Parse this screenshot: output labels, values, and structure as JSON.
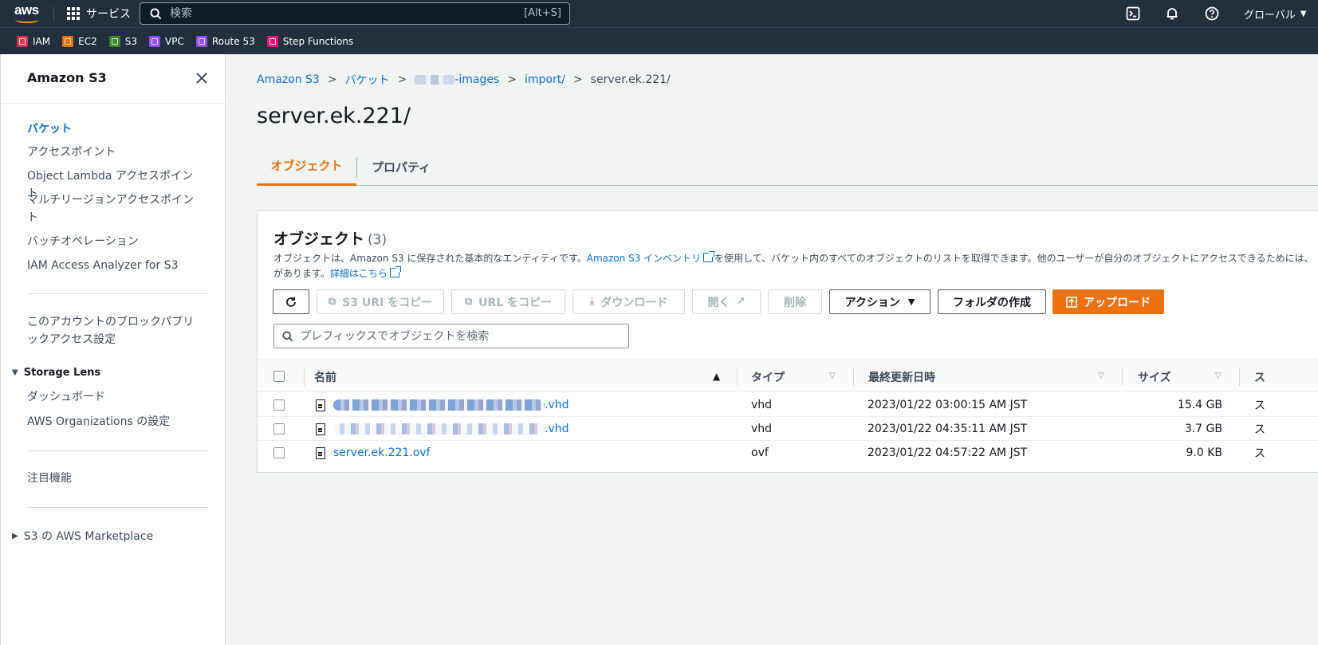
{
  "topnav": {
    "logo": "aws",
    "services_label": "サービス",
    "search_placeholder": "検索",
    "search_shortcut": "[Alt+S]",
    "region_label": "グローバル",
    "icons": [
      "cloudshell-icon",
      "bell-icon",
      "help-icon"
    ]
  },
  "favorites": [
    {
      "label": "IAM",
      "color": "#dd344c"
    },
    {
      "label": "EC2",
      "color": "#ed7100"
    },
    {
      "label": "S3",
      "color": "#3f8624"
    },
    {
      "label": "VPC",
      "color": "#8c4fff"
    },
    {
      "label": "Route 53",
      "color": "#8c4fff"
    },
    {
      "label": "Step Functions",
      "color": "#e7157b"
    }
  ],
  "sidebar": {
    "title": "Amazon S3",
    "items": [
      {
        "label": "バケット",
        "active": true
      },
      {
        "label": "アクセスポイント"
      },
      {
        "label": "Object Lambda アクセスポイント"
      },
      {
        "label": "マルチリージョンアクセスポイント"
      },
      {
        "label": "バッチオペレーション"
      },
      {
        "label": "IAM Access Analyzer for S3"
      }
    ],
    "block_public": "このアカウントのブロックパブリックアクセス設定",
    "storage_lens": {
      "label": "Storage Lens",
      "items": [
        {
          "label": "ダッシュボード"
        },
        {
          "label": "AWS Organizations の設定"
        }
      ]
    },
    "featured": "注目機能",
    "marketplace": "S3 の AWS Marketplace"
  },
  "breadcrumb": {
    "items": [
      "Amazon S3",
      "バケット",
      "-images",
      "import/",
      "server.ek.221/"
    ]
  },
  "page_title": "server.ek.221/",
  "tabs": [
    "オブジェクト",
    "プロパティ"
  ],
  "objects": {
    "title": "オブジェクト",
    "count": "(3)",
    "desc_1": "オブジェクトは、Amazon S3 に保存された基本的なエンティティです。",
    "desc_link1": "Amazon S3 インベントリ",
    "desc_2": "を使用して、バケット内のすべてのオブジェクトのリストを取得できます。他のユーザーが自分のオブジェクトにアクセスできるためには、明",
    "desc_3": "があります。",
    "desc_link2": "詳細はこちら",
    "buttons": {
      "refresh": "",
      "copy_s3_uri": "S3 URI をコピー",
      "copy_url": "URL をコピー",
      "download": "ダウンロード",
      "open": "開く",
      "delete": "削除",
      "actions": "アクション",
      "create_folder": "フォルダの作成",
      "upload": "アップロード"
    },
    "filter_placeholder": "プレフィックスでオブジェクトを検索",
    "columns": [
      "名前",
      "タイプ",
      "最終更新日時",
      "サイズ",
      "ス"
    ],
    "rows": [
      {
        "name_suffix": ".vhd",
        "type": "vhd",
        "modified": "2023/01/22 03:00:15 AM JST",
        "size": "15.4 GB",
        "class": "ス"
      },
      {
        "name_suffix": ".vhd",
        "type": "vhd",
        "modified": "2023/01/22 04:35:11 AM JST",
        "size": "3.7 GB",
        "class": "ス"
      },
      {
        "name_suffix": "server.ek.221.ovf",
        "type": "ovf",
        "modified": "2023/01/22 04:57:22 AM JST",
        "size": "9.0 KB",
        "class": "ス"
      }
    ]
  },
  "colors": {
    "nav_bg": "#232f3e",
    "accent": "#ec7211",
    "link": "#0972d3"
  }
}
